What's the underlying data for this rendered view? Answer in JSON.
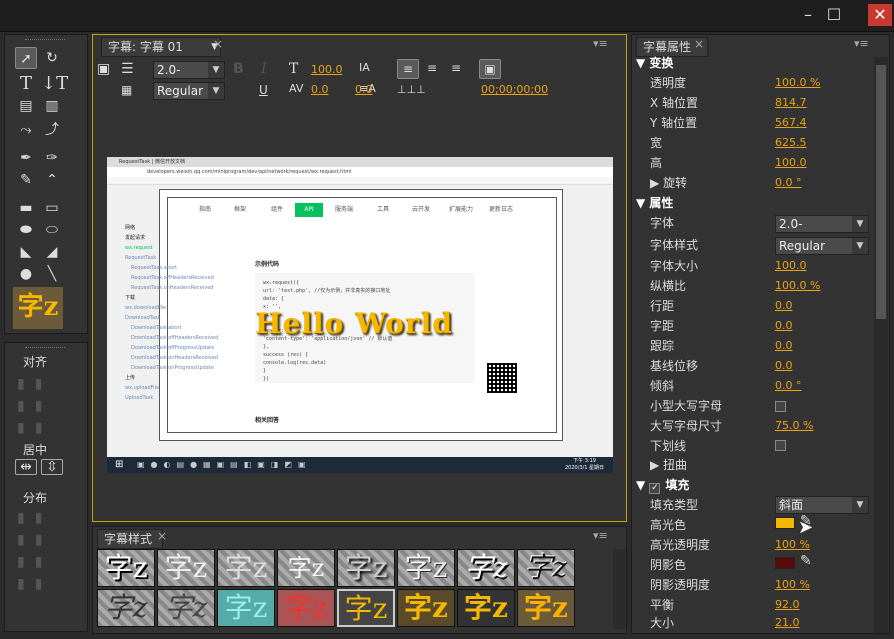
{
  "window": {
    "minimize": "–",
    "maximize": "☐",
    "close": "✕"
  },
  "tools_panel": {
    "align_title": "对齐",
    "center_title": "居中",
    "distribute_title": "分布",
    "preview_glyph": "字z"
  },
  "title_panel": {
    "tab_label": "字幕: 字幕 01",
    "font_family": "2.0-",
    "font_style": "Regular",
    "bold": "B",
    "italic": "I",
    "underline": "U",
    "font_size": "100.0",
    "aspect": "100.0",
    "kerning": "0.0",
    "leading": "0.0",
    "timecode": "00;00;00;00"
  },
  "canvas": {
    "overlay_text": "Hello World",
    "browser_url": "developers.weixin.qq.com/miniprogram/dev/api/network/request/wx.request.html",
    "browser_tab": "RequestTask | 微信开放文档",
    "nav_tabs": [
      "指南",
      "框架",
      "组件",
      "API",
      "服务端",
      "工具",
      "云开发",
      "扩展能力",
      "更新日志"
    ],
    "sidebar_items": [
      "网络",
      "发起请求",
      "wx.request",
      "RequestTask",
      "RequestTask.abort",
      "RequestTask.offHeadersReceived",
      "RequestTask.onHeadersReceived",
      "下载",
      "wx.downloadFile",
      "DownloadTask",
      "DownloadTask.abort",
      "DownloadTask.offHeadersReceived",
      "DownloadTask.offProgressUpdate",
      "DownloadTask.onHeadersReceived",
      "DownloadTask.onProgressUpdate",
      "上传",
      "wx.uploadFile",
      "UploadTask"
    ],
    "example_title": "示例代码",
    "related_title": "相关回答",
    "code_lines": [
      "wx.request({",
      "  url: 'test.php', //仅为示例，并非真实的接口地址",
      "  data: {",
      "    x: '',",
      "    y: ''",
      "  },",
      "  header: {",
      "    'content-type': 'application/json' // 默认值",
      "  },",
      "  success (res) {",
      "    console.log(res.data)",
      "  }",
      "})"
    ],
    "taskbar_time": "下午 3:19",
    "taskbar_date": "2020/3/1 星期日"
  },
  "styles_panel": {
    "tab_label": "字幕样式",
    "thumb_glyph": "字z"
  },
  "properties_panel": {
    "tab_label": "字幕属性",
    "transform_title": "变换",
    "opacity_label": "透明度",
    "opacity_value": "100.0 %",
    "x_label": "X 轴位置",
    "x_value": "814.7",
    "y_label": "Y 轴位置",
    "y_value": "567.4",
    "width_label": "宽",
    "width_value": "625.5",
    "height_label": "高",
    "height_value": "100.0",
    "rotation_label": "旋转",
    "rotation_value": "0.0 °",
    "attributes_title": "属性",
    "font_label": "字体",
    "font_value": "2.0-",
    "font_style_label": "字体样式",
    "font_style_value": "Regular",
    "font_size_label": "字体大小",
    "font_size_value": "100.0",
    "aspect_label": "纵横比",
    "aspect_value": "100.0 %",
    "leading_label": "行距",
    "leading_value": "0.0",
    "kerning_label": "字距",
    "kerning_value": "0.0",
    "tracking_label": "跟踪",
    "tracking_value": "0.0",
    "baseline_label": "基线位移",
    "baseline_value": "0.0",
    "slant_label": "倾斜",
    "slant_value": "0.0 °",
    "smallcaps_label": "小型大写字母",
    "smallcaps_size_label": "大写字母尺寸",
    "smallcaps_size_value": "75.0 %",
    "underline_label": "下划线",
    "distort_label": "扭曲",
    "fill_title": "填充",
    "fill_type_label": "填充类型",
    "fill_type_value": "斜面",
    "highlight_color_label": "高光色",
    "highlight_opacity_label": "高光透明度",
    "highlight_opacity_value": "100 %",
    "shadow_color_label": "阴影色",
    "shadow_opacity_label": "阴影透明度",
    "shadow_opacity_value": "100 %",
    "balance_label": "平衡",
    "balance_value": "92.0",
    "size_label": "大小",
    "size_value": "21.0"
  },
  "colors": {
    "accent": "#e8a317",
    "highlight": "#f5b800",
    "shadow": "#5a0a0a",
    "panel_border": "#c9a100"
  }
}
